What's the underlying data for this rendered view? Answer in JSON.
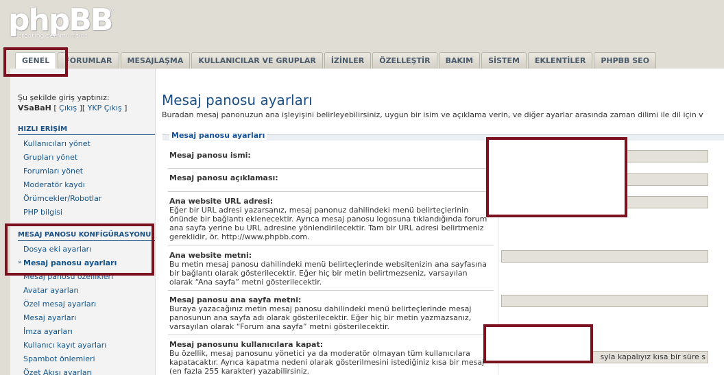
{
  "logo": {
    "main": "phpBB",
    "reg": "®",
    "sub": "creating communities"
  },
  "tabs": [
    {
      "label": "GENEL"
    },
    {
      "label": "FORUMLAR"
    },
    {
      "label": "MESAJLAŞMA"
    },
    {
      "label": "KULLANICILAR VE GRUPLAR"
    },
    {
      "label": "İZİNLER"
    },
    {
      "label": "ÖZELLEŞTİR"
    },
    {
      "label": "BAKIM"
    },
    {
      "label": "SİSTEM"
    },
    {
      "label": "EKLENTİLER"
    },
    {
      "label": "PHPBB SEO"
    }
  ],
  "sidebar": {
    "login_label": "Şu şekilde giriş yaptınız:",
    "username": "VSaBaH",
    "logout": "Çıkış",
    "acp_logout": "YKP Çıkış",
    "quick_title": "HIZLI ERİŞİM",
    "quick_items": [
      {
        "label": "Kullanıcıları yönet"
      },
      {
        "label": "Grupları yönet"
      },
      {
        "label": "Forumları yönet"
      },
      {
        "label": "Moderatör kaydı"
      },
      {
        "label": "Örümcekler/Robotlar"
      },
      {
        "label": "PHP bilgisi"
      }
    ],
    "config_title": "MESAJ PANOSU KONFİGÜRASYONU",
    "config_items": [
      {
        "label": "Dosya eki ayarları"
      },
      {
        "label": "Mesaj panosu ayarları"
      },
      {
        "label": "Mesaj panosu özellikleri"
      },
      {
        "label": "Avatar ayarları"
      },
      {
        "label": "Özel mesaj ayarları"
      },
      {
        "label": "Mesaj ayarları"
      },
      {
        "label": "İmza ayarları"
      },
      {
        "label": "Kullanıcı kayıt ayarları"
      },
      {
        "label": "Spambot önlemleri"
      },
      {
        "label": "Özet Akışı ayarları"
      }
    ]
  },
  "content": {
    "title": "Mesaj panosu ayarları",
    "description": "Buradan mesaj panonuzun ana işleyişini belirleyebilirsiniz, uygun bir isim ve açıklama verin, ve diğer ayarlar arasında zaman dilimi ile dil için v",
    "legend": "Mesaj panosu ayarları",
    "fields": [
      {
        "label": "Mesaj panosu ismi:",
        "explain": "",
        "value": ""
      },
      {
        "label": "Mesaj panosu açıklaması:",
        "explain": "",
        "value": ""
      },
      {
        "label": "Ana website URL adresi:",
        "explain": "Eğer bir URL adresi yazarsanız, mesaj panonuz dahilindeki menü belirteçlerinin önünde bir bağlantı eklenecektir. Ayrıca mesaj panosu logosuna tıklandığında forum ana sayfa yerine bu URL adresine yönlendirilecektir. Tam bir URL adresi belirtmeniz gereklidir, ör. http://www.phpbb.com.",
        "value": ""
      },
      {
        "label": "Ana website metni:",
        "explain": "Bu metin mesaj panosu dahilindeki menü belirteçlerinde websitenizin ana sayfasına bir bağlantı olarak gösterilecektir. Eğer hiç bir metin belirtmezseniz, varsayılan olarak “Ana sayfa” metni gösterilecektir.",
        "value": ""
      },
      {
        "label": "Mesaj panosu ana sayfa metni:",
        "explain": "Buraya yazacağınız metin mesaj panosu dahilindeki menü belirteçlerinde mesaj panosunun ana sayfa adı olarak gösterilecektir. Eğer hiç bir metin yazmazsanız, varsayılan olarak “Forum ana sayfa” metni gösterilecektir.",
        "value": ""
      },
      {
        "label": "Mesaj panosunu kullanıcılara kapat:",
        "explain": "Bu özellik, mesaj panosunu yönetici ya da moderatör olmayan tüm kullanıcılara kapatacaktır. Ayrıca kapatma nedeni olarak gösterilmesini istediğiniz kısa bir mesaj (en fazla 255 karakter) yazabilirsiniz.",
        "value": "syla kapalıyız kısa bir süre s"
      }
    ]
  }
}
